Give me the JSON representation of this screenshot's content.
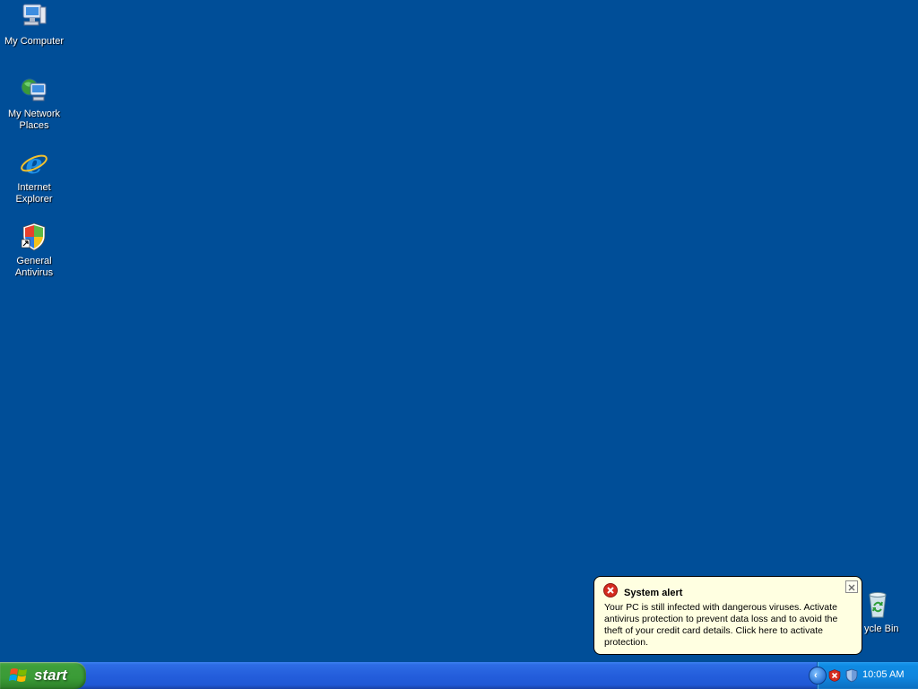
{
  "desktop": {
    "icons": [
      {
        "label": "My Computer"
      },
      {
        "label": "My Network Places"
      },
      {
        "label": "Internet Explorer"
      },
      {
        "label": "General Antivirus"
      },
      {
        "label": "Recycle Bin",
        "visible_label": "ycle Bin"
      }
    ],
    "background_color": "#004E98"
  },
  "balloon": {
    "title": "System alert",
    "message": "Your PC is still infected with dangerous viruses. Activate antivirus protection to prevent data loss and to avoid the theft of your credit card details. Click here to activate protection.",
    "icon": "error-icon",
    "close_icon": "close-icon"
  },
  "taskbar": {
    "start_label": "start",
    "clock": "10:05 AM",
    "tray_icons": [
      "chevron-left-icon",
      "alert-x-icon",
      "shield-icon"
    ]
  }
}
